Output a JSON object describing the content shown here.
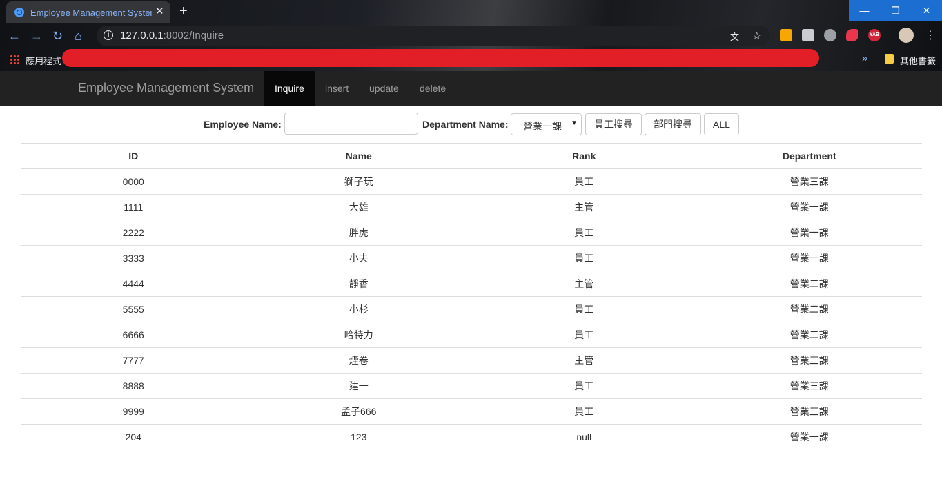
{
  "browser": {
    "tab_title": "Employee Management System",
    "tab_close": "✕",
    "new_tab": "+",
    "url_host": "127.0.0.1",
    "url_path": ":8002/Inquire",
    "window_controls": {
      "minimize": "—",
      "restore": "❐",
      "close": "✕"
    },
    "bookmarks": {
      "apps_label": "應用程式",
      "overflow": "»",
      "other_bookmarks": "其他書籤"
    },
    "ext_colors": [
      "#f7a800",
      "#c9ccd1",
      "#9aa0a6",
      "#e8364f",
      "#d3263a"
    ],
    "ext_yab": "YAB"
  },
  "navbar": {
    "brand": "Employee Management System",
    "items": [
      {
        "label": "Inquire",
        "active": true
      },
      {
        "label": "insert",
        "active": false
      },
      {
        "label": "update",
        "active": false
      },
      {
        "label": "delete",
        "active": false
      }
    ]
  },
  "search": {
    "employee_name_label": "Employee Name:",
    "employee_name_value": "",
    "department_name_label": "Department Name:",
    "department_selected": "營業一課",
    "buttons": {
      "employee_search": "員工搜尋",
      "department_search": "部門搜尋",
      "all": "ALL"
    }
  },
  "table": {
    "columns": [
      "ID",
      "Name",
      "Rank",
      "Department"
    ],
    "rows": [
      [
        "0000",
        "獅子玩",
        "員工",
        "營業三課"
      ],
      [
        "1111",
        "大雄",
        "主管",
        "營業一課"
      ],
      [
        "2222",
        "胖虎",
        "員工",
        "營業一課"
      ],
      [
        "3333",
        "小夫",
        "員工",
        "營業一課"
      ],
      [
        "4444",
        "靜香",
        "主管",
        "營業二課"
      ],
      [
        "5555",
        "小杉",
        "員工",
        "營業二課"
      ],
      [
        "6666",
        "哈特力",
        "員工",
        "營業二課"
      ],
      [
        "7777",
        "煙卷",
        "主管",
        "營業三課"
      ],
      [
        "8888",
        "建一",
        "員工",
        "營業三課"
      ],
      [
        "9999",
        "孟子666",
        "員工",
        "營業三課"
      ],
      [
        "204",
        "123",
        "null",
        "營業一課"
      ]
    ]
  }
}
